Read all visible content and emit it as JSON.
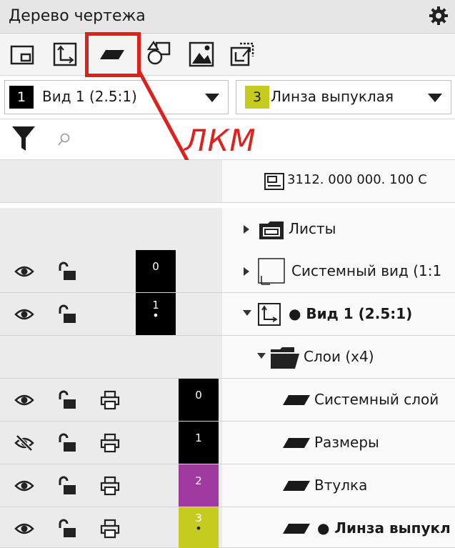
{
  "panel": {
    "title": "Дерево чертежа"
  },
  "toolbar": {
    "buttons": [
      "sheet-view-icon",
      "view-coordinate-icon",
      "layer-icon",
      "shapes-icon",
      "image-icon",
      "view-export-icon"
    ],
    "highlighted": "layer-icon",
    "annotation": "ЛКМ"
  },
  "selectors": {
    "view": {
      "number": "1",
      "label": "Вид 1 (2.5:1)",
      "color": "#000000"
    },
    "layer": {
      "number": "3",
      "label": "Линза выпуклая",
      "color": "#c6cc1f"
    }
  },
  "search": {
    "placeholder": ""
  },
  "tree": {
    "document": "3112. 000 000. 100 С",
    "sheets": "Листы",
    "system_view": {
      "label": "Системный вид (1:1",
      "number": "0"
    },
    "view1": {
      "label": "● Вид 1 (2.5:1)",
      "number": "1",
      "dot": "•"
    },
    "layers_folder": "Слои (x4)",
    "layers": [
      {
        "label": "Системный слой",
        "number": "0",
        "color": "#000000",
        "visible": true,
        "dot": ""
      },
      {
        "label": "Размеры",
        "number": "1",
        "color": "#000000",
        "visible": false,
        "dot": ""
      },
      {
        "label": "Втулка",
        "number": "2",
        "color": "#a03aa0",
        "visible": true,
        "dot": ""
      },
      {
        "label": "● Линза выпукл",
        "number": "3",
        "color": "#c6cc1f",
        "visible": true,
        "dot": "•"
      }
    ]
  },
  "colors": {
    "accent_red": "#e0201c"
  }
}
